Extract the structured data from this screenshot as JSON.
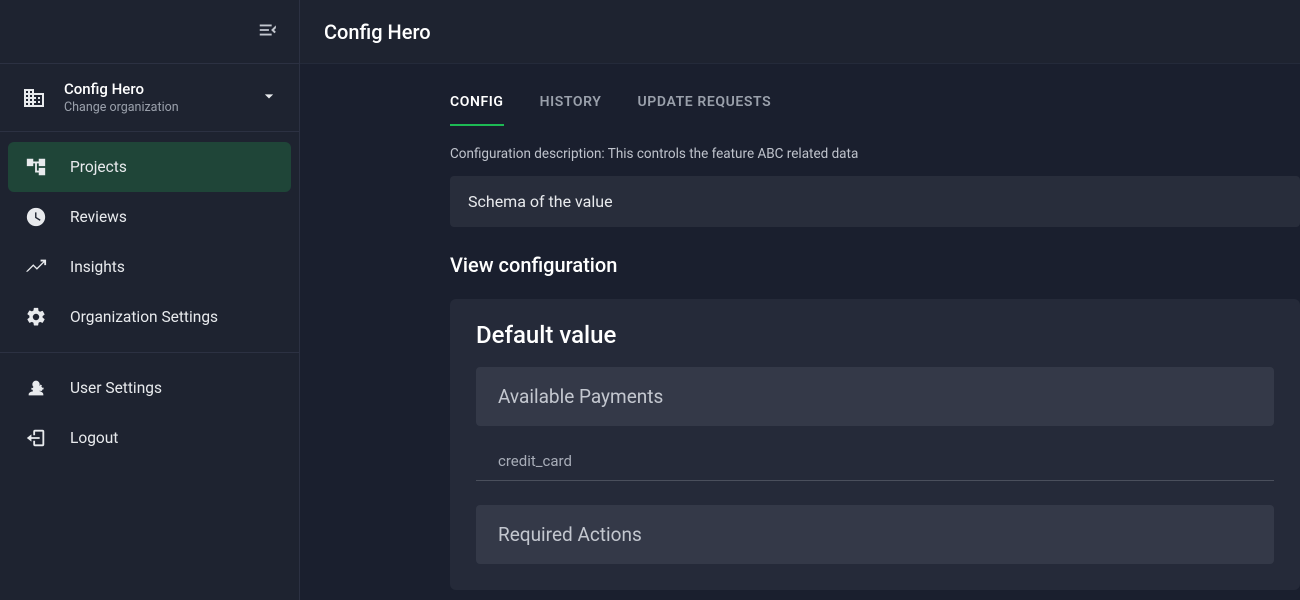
{
  "sidebar": {
    "org": {
      "name": "Config Hero",
      "sub": "Change organization"
    },
    "nav_primary": [
      {
        "label": "Projects",
        "icon": "projects",
        "active": true
      },
      {
        "label": "Reviews",
        "icon": "reviews",
        "active": false
      },
      {
        "label": "Insights",
        "icon": "insights",
        "active": false
      },
      {
        "label": "Organization Settings",
        "icon": "settings",
        "active": false
      }
    ],
    "nav_secondary": [
      {
        "label": "User Settings",
        "icon": "user-settings"
      },
      {
        "label": "Logout",
        "icon": "logout"
      }
    ]
  },
  "topbar": {
    "title": "Config Hero"
  },
  "tabs": [
    {
      "label": "CONFIG",
      "active": true
    },
    {
      "label": "HISTORY",
      "active": false
    },
    {
      "label": "UPDATE REQUESTS",
      "active": false
    }
  ],
  "config": {
    "description_prefix": "Configuration description: ",
    "description_body": "This controls the feature ABC related data",
    "schema_panel": "Schema of the value",
    "view_heading": "View configuration",
    "default_value": {
      "title": "Default value",
      "panels": [
        {
          "heading": "Available Payments",
          "value": "credit_card"
        },
        {
          "heading": "Required Actions",
          "value": ""
        }
      ]
    }
  }
}
